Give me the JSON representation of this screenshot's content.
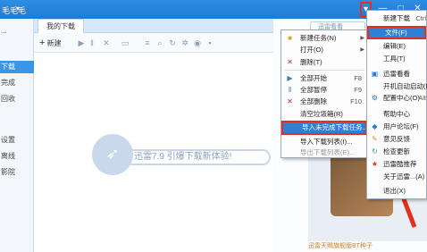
{
  "titlebar": {
    "username": "毛毛毛",
    "window_buttons": [
      "▾",
      "—",
      "□",
      "✕"
    ]
  },
  "sidebar": {
    "items": [
      "...",
      "下载",
      "完成",
      "回收",
      "",
      "",
      "设置",
      "离线",
      "影院"
    ]
  },
  "tabs": {
    "active": "我的下载"
  },
  "toolbar": {
    "new_label": "新建",
    "icons": [
      "play-icon",
      "pause-icon",
      "delete-icon",
      "folder-icon",
      "list-icon",
      "search-icon",
      "settings-icon",
      "share-icon",
      "more-icon"
    ]
  },
  "empty_state": {
    "message": "迅雷7.9 引爆下载新体验!"
  },
  "search": {
    "placeholder": "迅雷看看"
  },
  "promo": {
    "caption": "迅雷天赐旗舰版BT种子"
  },
  "file_menu": {
    "items": [
      {
        "label": "新建任务(N)",
        "shortcut": "",
        "submenu": true,
        "icon": "folder-icon"
      },
      {
        "label": "打开(O)",
        "shortcut": "",
        "submenu": true,
        "icon": ""
      },
      {
        "label": "删除(T)",
        "shortcut": "",
        "submenu": false,
        "icon": "x-icon"
      },
      {
        "label": "全部开始",
        "shortcut": "F8",
        "submenu": false,
        "icon": "play-icon"
      },
      {
        "label": "全部暂停",
        "shortcut": "F9",
        "submenu": false,
        "icon": "pause-icon"
      },
      {
        "label": "全部删除",
        "shortcut": "F10",
        "submenu": false,
        "icon": "x-icon"
      },
      {
        "label": "清空垃圾箱(R)",
        "shortcut": "",
        "submenu": false,
        "icon": ""
      },
      {
        "label": "导入未完成下载任务...",
        "shortcut": "",
        "submenu": false,
        "icon": "",
        "highlighted": true
      },
      {
        "label": "导入下载列表(I)...",
        "shortcut": "",
        "submenu": false,
        "icon": ""
      },
      {
        "label": "导出下载列表(E)...",
        "shortcut": "",
        "submenu": false,
        "icon": "",
        "disabled": true
      }
    ]
  },
  "main_menu": {
    "items": [
      {
        "label": "新建下载",
        "shortcut": "Ctrl",
        "icon": ""
      },
      {
        "label": "文件(F)",
        "shortcut": "",
        "icon": "",
        "highlighted": true
      },
      {
        "label": "编辑(E)",
        "shortcut": "",
        "icon": ""
      },
      {
        "label": "工具(T)",
        "shortcut": "",
        "icon": ""
      },
      {
        "label": "迅雷看看",
        "shortcut": "",
        "icon": "tv-icon"
      },
      {
        "label": "开机自动启动(R)",
        "shortcut": "",
        "icon": ""
      },
      {
        "label": "配置中心(O)",
        "shortcut": "Alt",
        "icon": "gear-icon"
      },
      {
        "label": "帮助中心",
        "shortcut": "",
        "icon": ""
      },
      {
        "label": "用户论坛(F)",
        "shortcut": "",
        "icon": "forum-icon"
      },
      {
        "label": "意见反馈",
        "shortcut": "",
        "icon": "feedback-icon"
      },
      {
        "label": "检查更新",
        "shortcut": "",
        "icon": "update-icon"
      },
      {
        "label": "迅雷酷推荐",
        "shortcut": "",
        "icon": "star-icon"
      },
      {
        "label": "关于迅雷...(A)",
        "shortcut": "",
        "icon": ""
      },
      {
        "label": "退出(X)",
        "shortcut": "",
        "icon": ""
      }
    ]
  },
  "colors": {
    "titlebar": "#1f7bd3",
    "highlight": "#e0301e",
    "menu_hover": "#2f7fd6"
  }
}
